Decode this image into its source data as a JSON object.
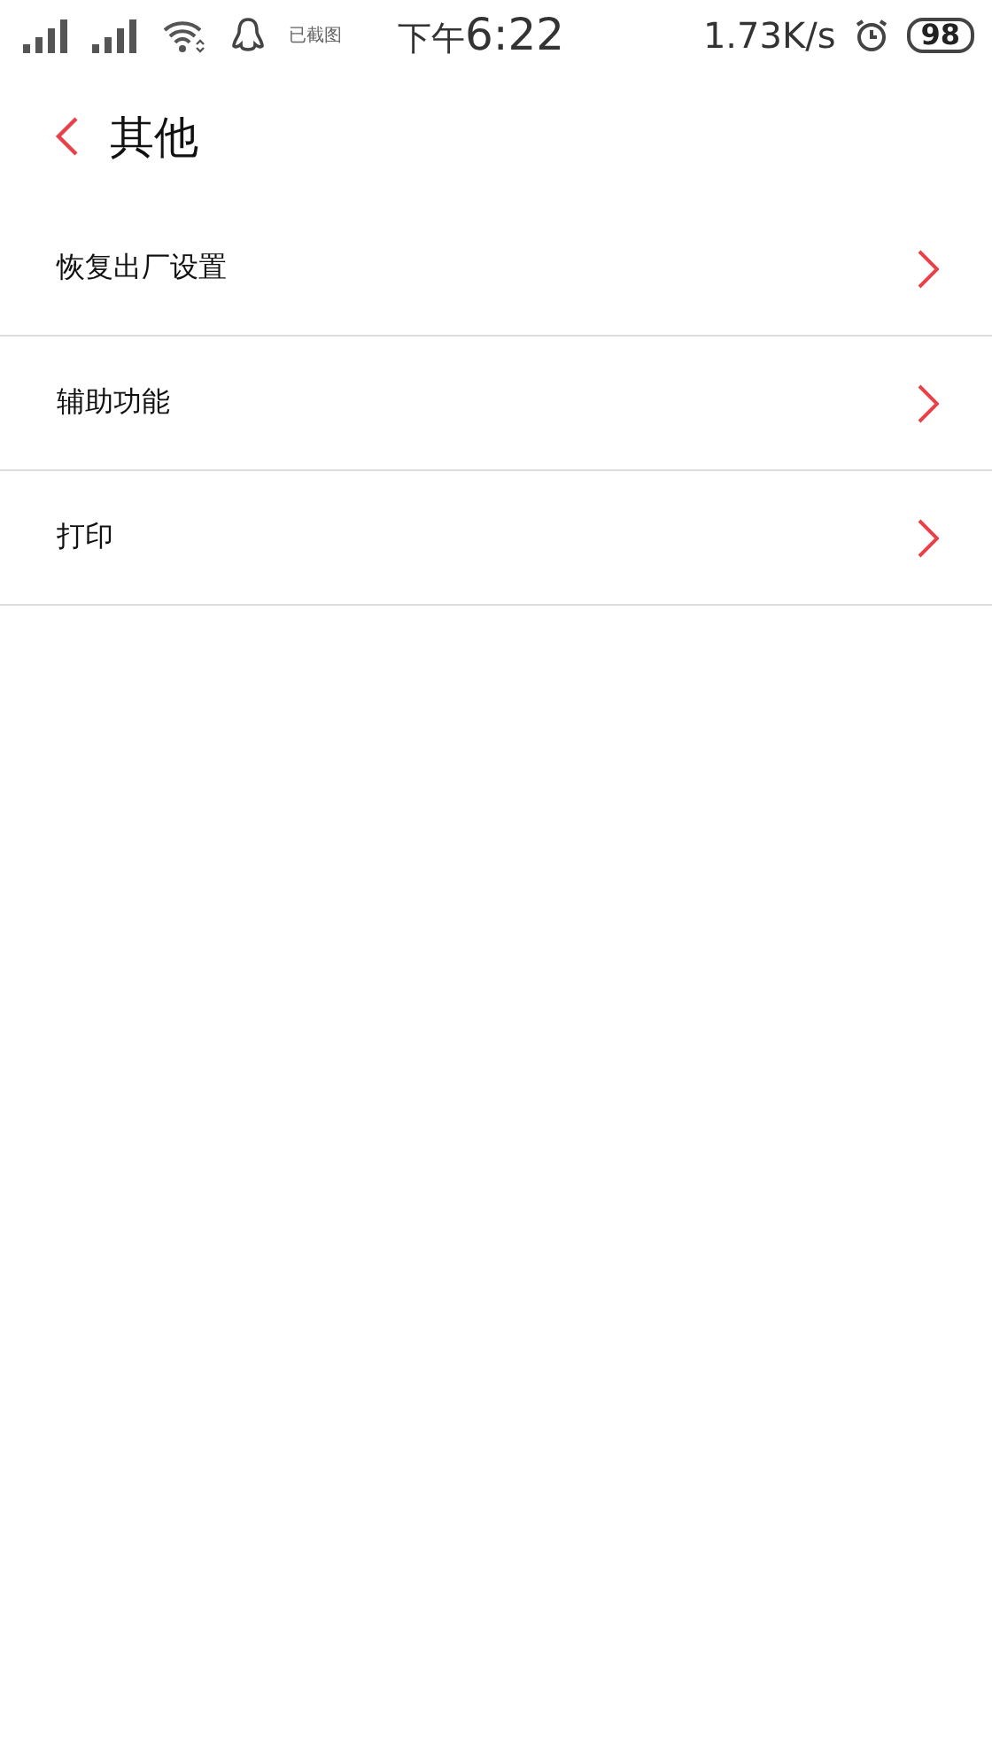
{
  "status_bar": {
    "screenshot_note": "已截图",
    "period": "下午",
    "time": "6:22",
    "net_speed": "1.73K/s",
    "battery": "98"
  },
  "header": {
    "title": "其他"
  },
  "items": [
    {
      "label": "恢复出厂设置"
    },
    {
      "label": "辅助功能"
    },
    {
      "label": "打印"
    }
  ]
}
